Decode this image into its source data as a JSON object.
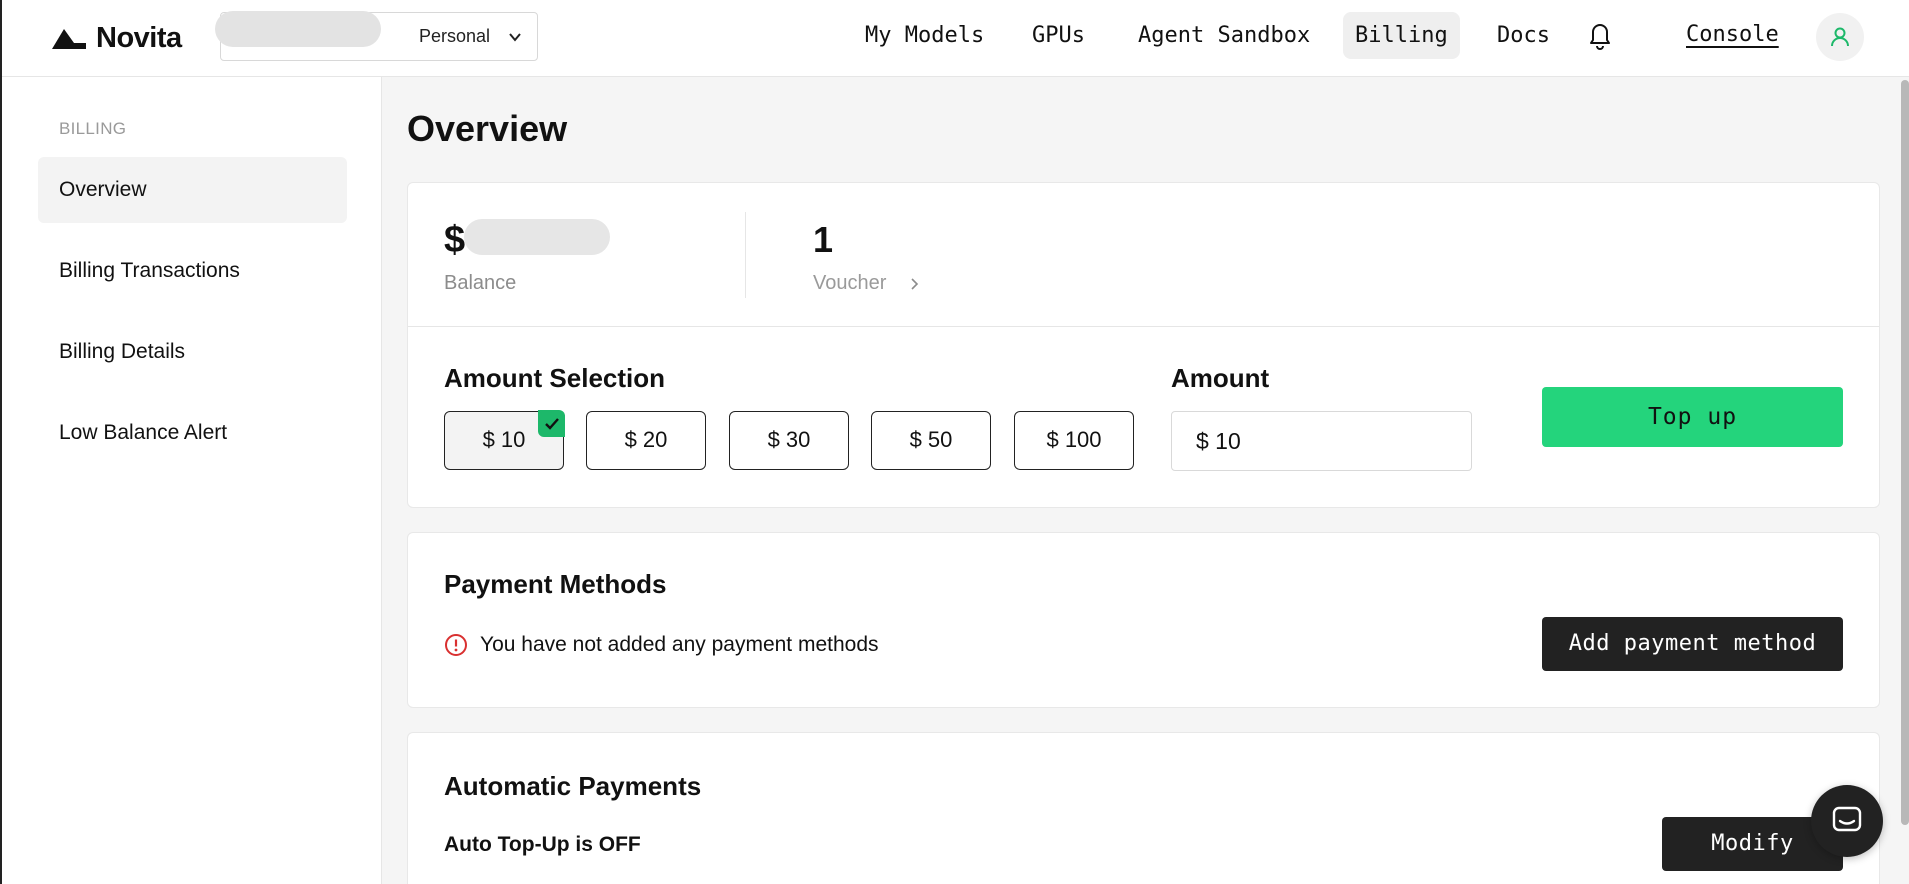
{
  "header": {
    "brand": "Novita",
    "team_selector": {
      "selected": "Personal"
    },
    "nav": [
      {
        "label": "My Models",
        "active": false
      },
      {
        "label": "GPUs",
        "active": false
      },
      {
        "label": "Agent Sandbox",
        "active": false
      },
      {
        "label": "Billing",
        "active": true
      },
      {
        "label": "Docs",
        "active": false
      }
    ],
    "console_label": "Console",
    "icons": {
      "notifications": "bell-icon",
      "profile": "user-icon"
    }
  },
  "sidebar": {
    "heading": "BILLING",
    "items": [
      {
        "label": "Overview",
        "active": true
      },
      {
        "label": "Billing Transactions",
        "active": false
      },
      {
        "label": "Billing Details",
        "active": false
      },
      {
        "label": "Low Balance Alert",
        "active": false
      }
    ]
  },
  "main": {
    "title": "Overview",
    "balance": {
      "currency_symbol": "$",
      "label": "Balance"
    },
    "voucher": {
      "count": "1",
      "label": "Voucher"
    },
    "amount_selection": {
      "title": "Amount Selection",
      "options": [
        "$ 10",
        "$ 20",
        "$ 30",
        "$ 50",
        "$ 100"
      ],
      "selected_index": 0
    },
    "amount": {
      "title": "Amount",
      "value": "$ 10"
    },
    "topup_label": "Top up",
    "payment_methods": {
      "title": "Payment Methods",
      "empty_message": "You have not added any payment methods",
      "add_label": "Add payment method"
    },
    "automatic_payments": {
      "title": "Automatic Payments",
      "status": "Auto Top-Up is OFF",
      "modify_label": "Modify"
    }
  },
  "colors": {
    "accent_green": "#24d47c",
    "check_green": "#1db86a",
    "dark_button": "#222222",
    "warning_red": "#d93030"
  }
}
